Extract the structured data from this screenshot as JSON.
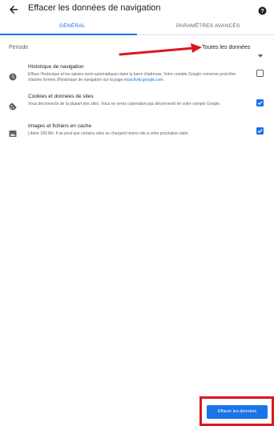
{
  "header": {
    "title": "Effacer les données de navigation",
    "back_icon": "arrow-back-icon",
    "help_icon": "help-icon"
  },
  "tabs": [
    {
      "label": "GÉNÉRAL",
      "selected": true
    },
    {
      "label": "PARAMÈTRES AVANCÉS",
      "selected": false
    }
  ],
  "period": {
    "label": "Période",
    "value": "Toutes les données",
    "icon": "caret-down-icon"
  },
  "options": [
    {
      "title": "Historique de navigation",
      "description": "Efface l'historique et les saisies semi-automatiques dans la barre d'adresse. Votre compte Google conserve peut-être d'autres formes d'historique de navigation sur la page ",
      "link": "myactivity.google.com",
      "link_suffix": ".",
      "icon": "clock-icon",
      "checked": false
    },
    {
      "title": "Cookies et données de sites",
      "description": "Vous déconnecte de la plupart des sites. Vous ne serez cependant pas déconnecté de votre compte Google.",
      "icon": "cookie-icon",
      "checked": true
    },
    {
      "title": "Images et fichiers en cache",
      "description": "Libère 183 Mo. Il se peut que certains sites se chargent moins vite à votre prochaine visite.",
      "icon": "image-icon",
      "checked": true
    }
  ],
  "footer": {
    "submit_label": "Effacer les données"
  },
  "colors": {
    "accent": "#1a73e8",
    "annotation": "#d7191f"
  }
}
